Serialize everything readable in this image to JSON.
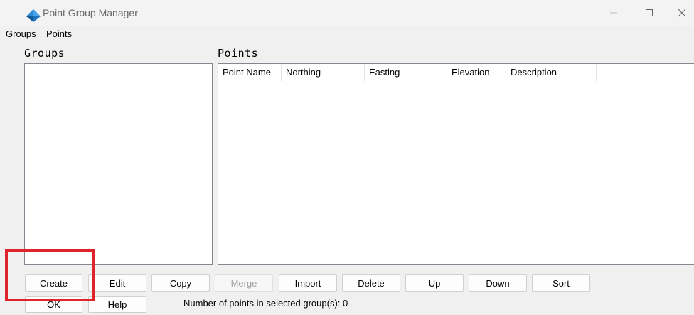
{
  "window": {
    "title": "Point Group Manager",
    "icons": {
      "app": "survey-pyramid-icon",
      "minimize": "minimize-icon",
      "maximize": "maximize-icon",
      "close": "close-icon"
    }
  },
  "menubar": {
    "items": [
      {
        "label": "Groups"
      },
      {
        "label": "Points"
      }
    ]
  },
  "groups": {
    "label": "Groups",
    "items": []
  },
  "points": {
    "label": "Points",
    "columns": [
      "Point Name",
      "Northing",
      "Easting",
      "Elevation",
      "Description"
    ],
    "rows": []
  },
  "buttons": {
    "row1": [
      {
        "label": "Create",
        "enabled": true
      },
      {
        "label": "Edit",
        "enabled": true
      },
      {
        "label": "Copy",
        "enabled": true
      },
      {
        "label": "Merge",
        "enabled": false
      },
      {
        "label": "Import",
        "enabled": true
      },
      {
        "label": "Delete",
        "enabled": true
      },
      {
        "label": "Up",
        "enabled": true
      },
      {
        "label": "Down",
        "enabled": true
      },
      {
        "label": "Sort",
        "enabled": true
      }
    ],
    "row2": [
      {
        "label": "OK",
        "enabled": true
      },
      {
        "label": "Help",
        "enabled": true
      }
    ]
  },
  "status": {
    "text": "Number of points in selected group(s): 0"
  },
  "annotation": {
    "color": "#e0232a"
  }
}
